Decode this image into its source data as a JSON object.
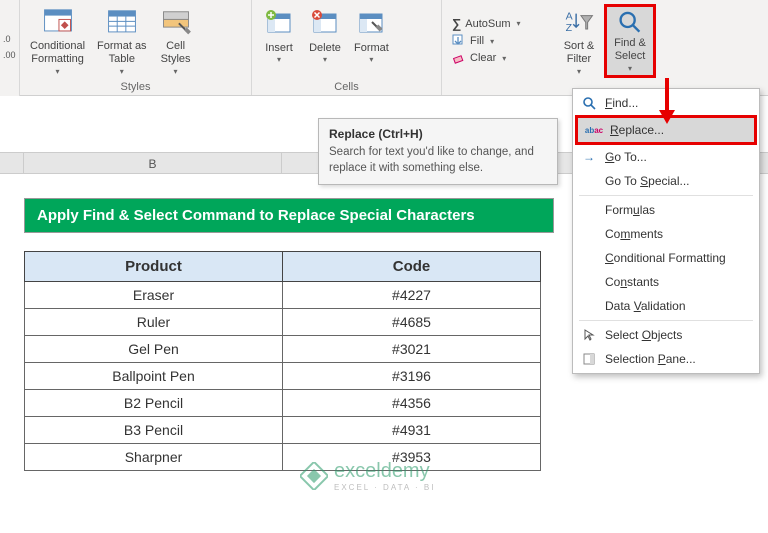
{
  "ribbon": {
    "styles": {
      "label": "Styles",
      "cond": "Conditional\nFormatting",
      "fmtas": "Format as\nTable",
      "cell": "Cell\nStyles"
    },
    "cells": {
      "label": "Cells",
      "insert": "Insert",
      "delete": "Delete",
      "format": "Format"
    },
    "editing": {
      "autosum": "AutoSum",
      "fill": "Fill",
      "clear": "Clear",
      "sort": "Sort &\nFilter",
      "find": "Find &\nSelect"
    }
  },
  "tooltip": {
    "title": "Replace (Ctrl+H)",
    "body": "Search for text you'd like to change, and replace it with something else."
  },
  "menu": {
    "find": "Find...",
    "replace": "Replace...",
    "goto": "Go To...",
    "gotospecial": "Go To Special...",
    "formulas": "Formulas",
    "comments": "Comments",
    "condfmt": "Conditional Formatting",
    "constants": "Constants",
    "datavalid": "Data Validation",
    "selobjects": "Select Objects",
    "selpane": "Selection Pane..."
  },
  "colB": "B",
  "sheet": {
    "title": "Apply Find & Select Command to Replace Special Characters",
    "headers": {
      "product": "Product",
      "code": "Code"
    },
    "rows": [
      {
        "p": "Eraser",
        "c": "#4227"
      },
      {
        "p": "Ruler",
        "c": "#4685"
      },
      {
        "p": "Gel Pen",
        "c": "#3021"
      },
      {
        "p": "Ballpoint Pen",
        "c": "#3196"
      },
      {
        "p": "B2 Pencil",
        "c": "#4356"
      },
      {
        "p": "B3 Pencil",
        "c": "#4931"
      },
      {
        "p": "Sharpner",
        "c": "#3953"
      }
    ]
  },
  "watermark": {
    "brand": "exceldemy",
    "tag": "EXCEL · DATA · BI"
  },
  "chart_data": {
    "type": "table",
    "title": "Apply Find & Select Command to Replace Special Characters",
    "columns": [
      "Product",
      "Code"
    ],
    "rows": [
      [
        "Eraser",
        "#4227"
      ],
      [
        "Ruler",
        "#4685"
      ],
      [
        "Gel Pen",
        "#3021"
      ],
      [
        "Ballpoint Pen",
        "#3196"
      ],
      [
        "B2 Pencil",
        "#4356"
      ],
      [
        "B3 Pencil",
        "#4931"
      ],
      [
        "Sharpner",
        "#3953"
      ]
    ]
  }
}
